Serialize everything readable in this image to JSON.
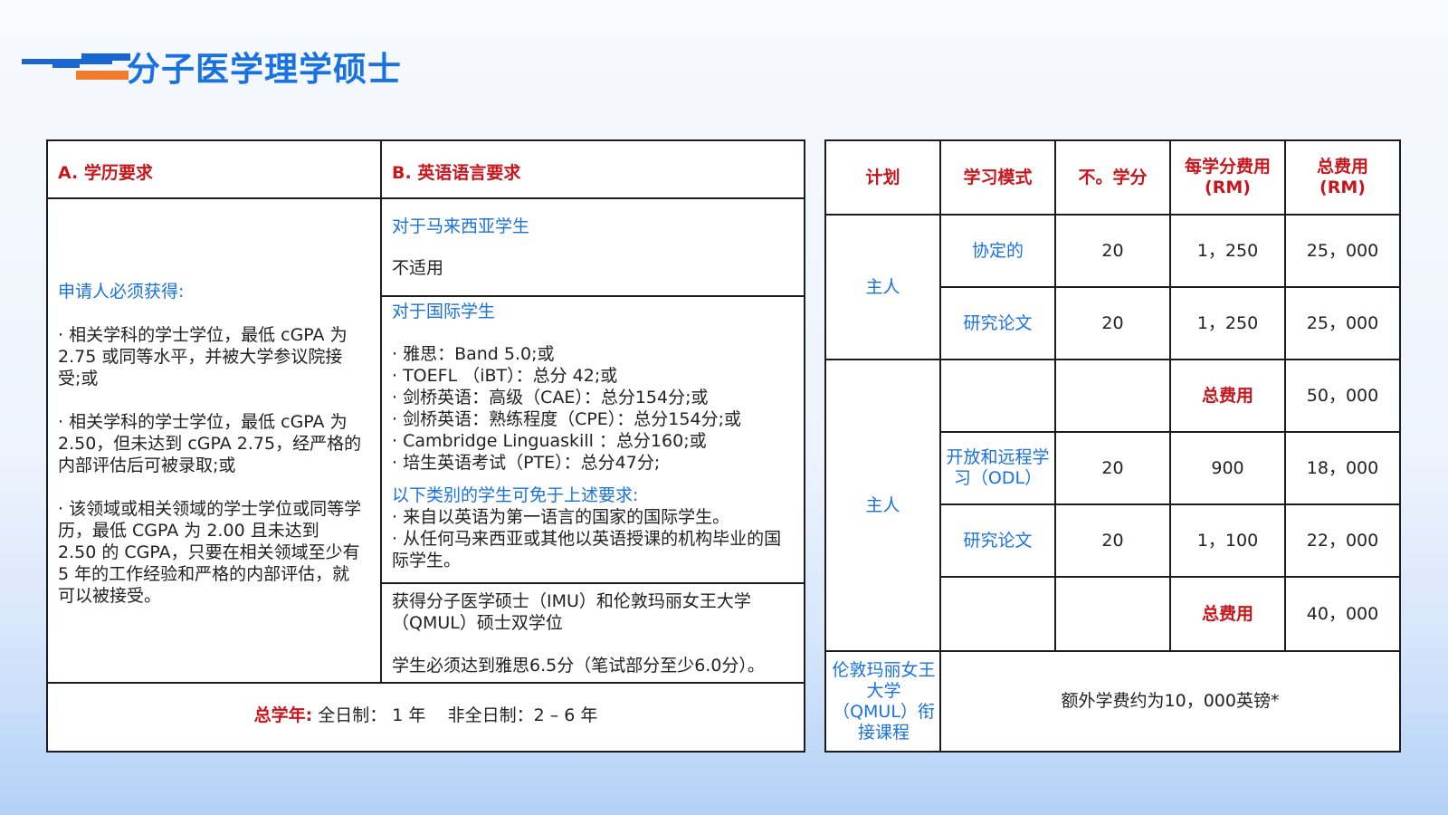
{
  "title": "分子医学理学硕士",
  "left": {
    "col_a_header": "A. 学历要求",
    "col_b_header": "B. 英语语言要求",
    "a_intro": "申请人必须获得:",
    "a_items": [
      "· 相关学科的学士学位，最低 cGPA 为 2.75 或同等水平，并被大学参议院接受;或",
      "· 相关学科的学士学位，最低 cGPA 为 2.50，但未达到 cGPA 2.75，经严格的内部评估后可被录取;或",
      "· 该领域或相关领域的学士学位或同等学历，最低 CGPA 为 2.00 且未达到 2.50 的 CGPA，只要在相关领域至少有 5 年的工作经验和严格的内部评估，就可以被接受。"
    ],
    "b_malaysian_title": "对于马来西亚学生",
    "b_malaysian_text": "不适用",
    "b_intl_title": "对于国际学生",
    "b_intl_items": [
      "· 雅思：Band 5.0;或",
      "· TOEFL （iBT）：总分 42;或",
      "· 剑桥英语：高级（CAE）：总分154分;或",
      "· 剑桥英语：熟练程度（CPE）：总分154分;或",
      "· Cambridge Linguaskill ：总分160;或",
      "· 培生英语考试（PTE）：总分47分;"
    ],
    "b_exempt_title": "以下类别的学生可免于上述要求:",
    "b_exempt_items": [
      "· 来自以英语为第一语言的国家的国际学生。",
      "· 从任何马来西亚或其他以英语授课的机构毕业的国际学生。"
    ],
    "b_dual_title": "获得分子医学硕士（IMU）和伦敦玛丽女王大学（QMUL）硕士双学位",
    "b_dual_text": "学生必须达到雅思6.5分（笔试部分至少6.0分）。",
    "footer_label": "总学年:",
    "footer_text": " 全日制： 1 年    非全日制：2 – 6 年"
  },
  "right": {
    "headers": [
      "计划",
      "学习模式",
      "不。学分",
      "每学分费用\n(RM)",
      "总费用\n(RM)"
    ],
    "group1_plan": "主人",
    "group2_plan": "主人",
    "qmul_plan": "伦敦玛丽女王大学（QMUL）衔接课程",
    "rows": [
      {
        "mode": "协定的",
        "credits": "20",
        "per": "1，250",
        "total": "25，000"
      },
      {
        "mode": "研究论文",
        "credits": "20",
        "per": "1，250",
        "total": "25，000"
      },
      {
        "mode": "",
        "credits": "",
        "per": "总费用",
        "total": "50，000"
      },
      {
        "mode": "开放和远程学习（ODL）",
        "credits": "20",
        "per": "900",
        "total": "18，000"
      },
      {
        "mode": "研究论文",
        "credits": "20",
        "per": "1，100",
        "total": "22，000"
      },
      {
        "mode": "",
        "credits": "",
        "per": "总费用",
        "total": "40，000"
      }
    ],
    "qmul_text": "额外学费约为10，000英镑*"
  },
  "colors": {
    "accent": "#1a72e0",
    "red": "#c8161d",
    "orange": "#f07b2c"
  },
  "icons": [
    "title-logo-icon"
  ]
}
